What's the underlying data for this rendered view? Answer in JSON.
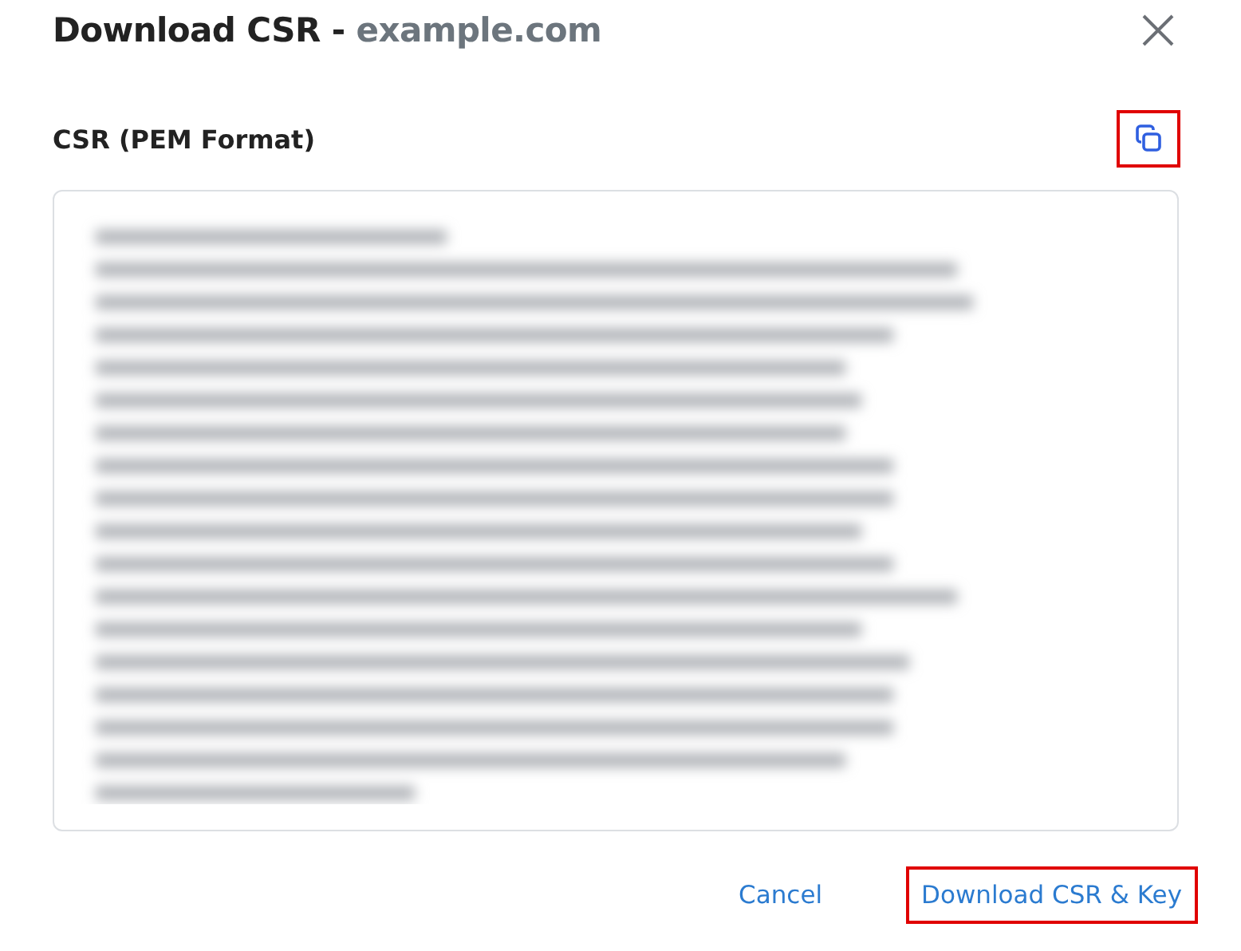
{
  "dialog": {
    "title": "Download CSR - ",
    "domain": "example.com"
  },
  "field": {
    "label": "CSR (PEM Format)",
    "copy_highlighted": true
  },
  "buttons": [
    {
      "label": "Cancel",
      "kind": "text",
      "highlighted": false
    },
    {
      "label": "Download CSR & Key",
      "kind": "text",
      "highlighted": true
    }
  ]
}
